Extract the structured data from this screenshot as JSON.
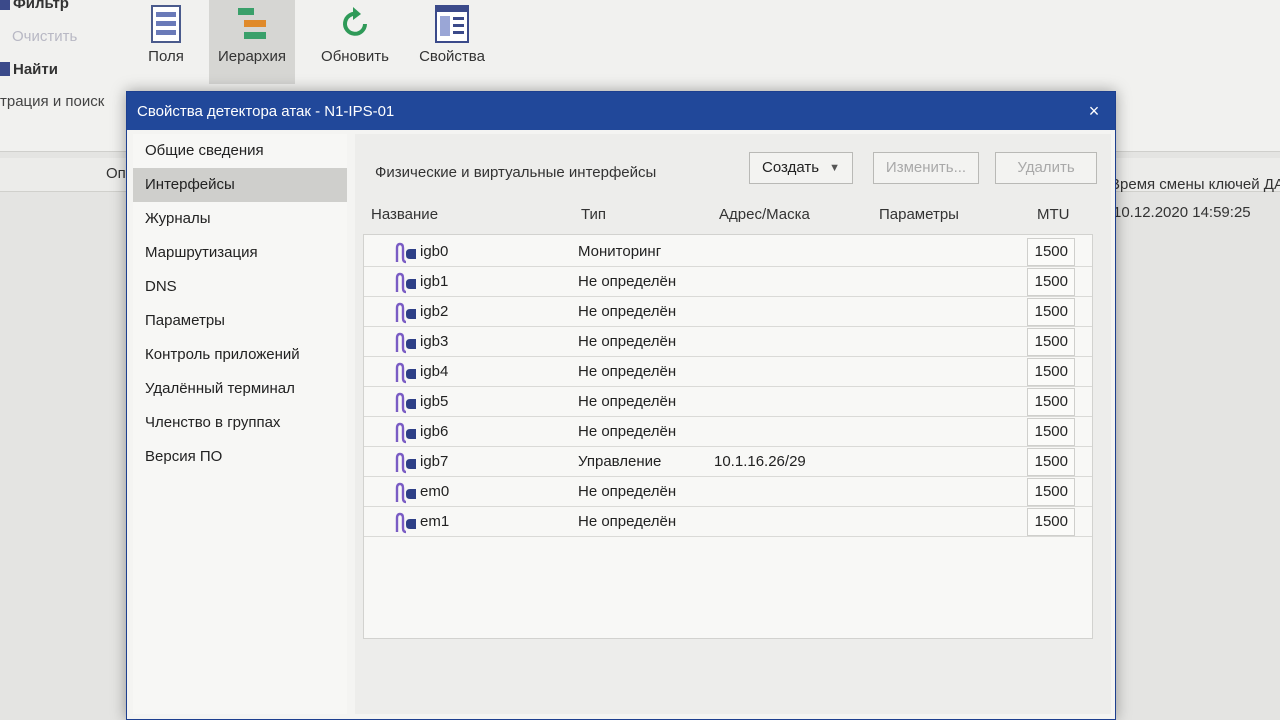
{
  "background": {
    "left_commands": [
      {
        "label": "Фильтр",
        "state": "normal"
      },
      {
        "label": "Очистить",
        "state": "disabled"
      },
      {
        "label": "Найти",
        "state": "normal"
      },
      {
        "label": "трация и поиск",
        "state": "plain"
      }
    ],
    "ribbon": [
      {
        "label": "Поля",
        "icon": "fields-icon"
      },
      {
        "label": "Иерархия",
        "icon": "hierarchy-icon",
        "active": true
      },
      {
        "label": "Обновить",
        "icon": "refresh-icon"
      },
      {
        "label": "Свойства",
        "icon": "properties-icon"
      }
    ],
    "grid": {
      "left_header": "Оп",
      "right_header": "Время смены ключей ДА",
      "right_cell": "10.12.2020 14:59:25"
    }
  },
  "dialog": {
    "title": "Свойства детектора атак - N1-IPS-01",
    "close_glyph": "×",
    "nav": [
      {
        "label": "Общие сведения"
      },
      {
        "label": "Интерфейсы",
        "selected": true
      },
      {
        "label": "Журналы"
      },
      {
        "label": "Маршрутизация"
      },
      {
        "label": "DNS"
      },
      {
        "label": "Параметры"
      },
      {
        "label": "Контроль приложений"
      },
      {
        "label": "Удалённый терминал"
      },
      {
        "label": "Членство в группах"
      },
      {
        "label": "Версия ПО"
      }
    ],
    "section_title": "Физические и виртуальные интерфейсы",
    "buttons": {
      "create": "Создать",
      "edit": "Изменить...",
      "delete": "Удалить"
    },
    "columns": {
      "name": "Название",
      "type": "Тип",
      "address": "Адрес/Маска",
      "params": "Параметры",
      "mtu": "MTU"
    },
    "rows": [
      {
        "name": "igb0",
        "type": "Мониторинг",
        "address": "",
        "params": "",
        "mtu": "1500"
      },
      {
        "name": "igb1",
        "type": "Не определён",
        "address": "",
        "params": "",
        "mtu": "1500"
      },
      {
        "name": "igb2",
        "type": "Не определён",
        "address": "",
        "params": "",
        "mtu": "1500"
      },
      {
        "name": "igb3",
        "type": "Не определён",
        "address": "",
        "params": "",
        "mtu": "1500"
      },
      {
        "name": "igb4",
        "type": "Не определён",
        "address": "",
        "params": "",
        "mtu": "1500"
      },
      {
        "name": "igb5",
        "type": "Не определён",
        "address": "",
        "params": "",
        "mtu": "1500"
      },
      {
        "name": "igb6",
        "type": "Не определён",
        "address": "",
        "params": "",
        "mtu": "1500"
      },
      {
        "name": "igb7",
        "type": "Управление",
        "address": "10.1.16.26/29",
        "params": "",
        "mtu": "1500"
      },
      {
        "name": "em0",
        "type": "Не определён",
        "address": "",
        "params": "",
        "mtu": "1500"
      },
      {
        "name": "em1",
        "type": "Не определён",
        "address": "",
        "params": "",
        "mtu": "1500"
      }
    ],
    "colors": {
      "titlebar": "#21489a",
      "interface_icon_dark": "#2d3f86",
      "interface_icon_light": "#7a5cc4"
    }
  }
}
